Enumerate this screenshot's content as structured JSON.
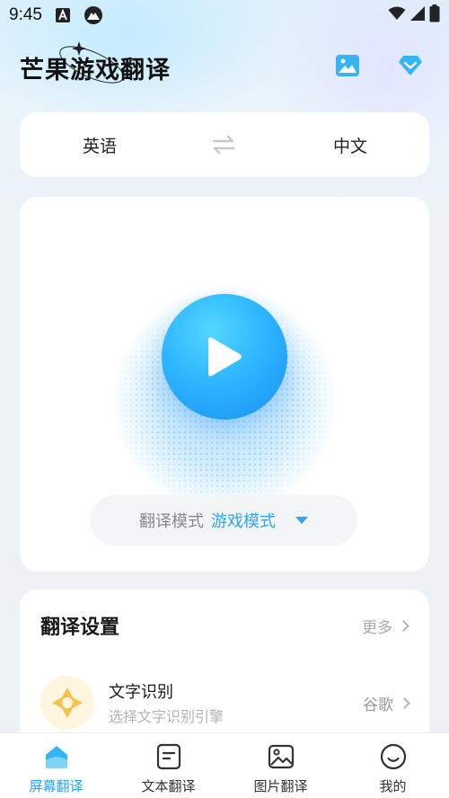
{
  "status_bar": {
    "time": "9:45"
  },
  "header": {
    "app_title": "芒果游戏翻译"
  },
  "languages": {
    "source": "英语",
    "target": "中文"
  },
  "main": {
    "mode_label": "翻译模式",
    "mode_value": "游戏模式"
  },
  "settings": {
    "title": "翻译设置",
    "more_label": "更多",
    "ocr": {
      "name": "文字识别",
      "description": "选择文字识别引擎",
      "engine": "谷歌"
    }
  },
  "nav": [
    {
      "label": "屏幕翻译",
      "icon": "screen-translate-icon",
      "active": true
    },
    {
      "label": "文本翻译",
      "icon": "text-translate-icon",
      "active": false
    },
    {
      "label": "图片翻译",
      "icon": "image-translate-icon",
      "active": false
    },
    {
      "label": "我的",
      "icon": "profile-icon",
      "active": false
    }
  ],
  "colors": {
    "accent": "#2ba6f0",
    "play": "#2db6ff",
    "ocr_icon": "#f5c24a"
  }
}
